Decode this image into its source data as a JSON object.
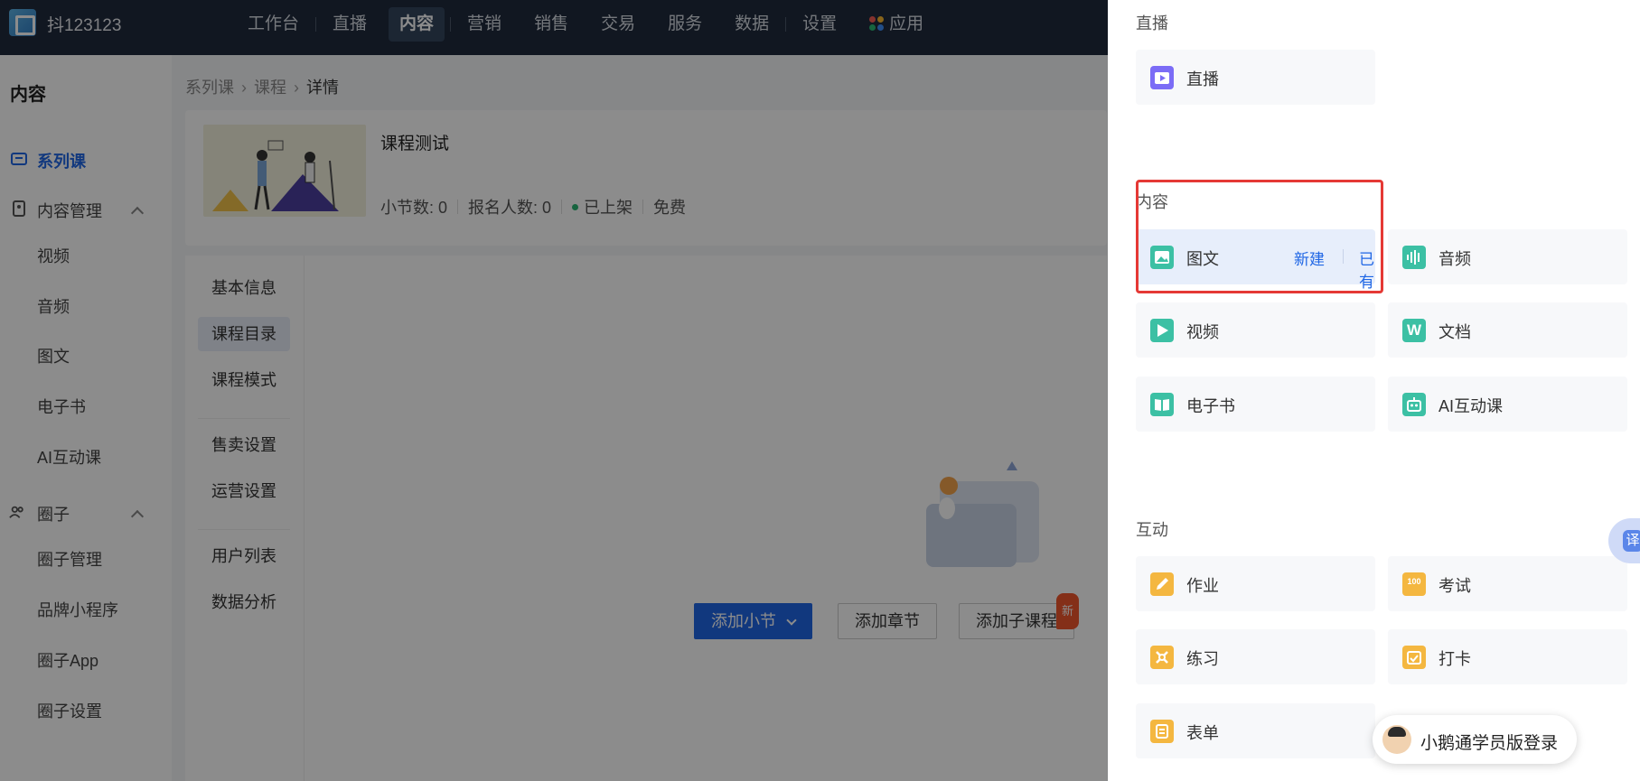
{
  "topbar": {
    "brand": "抖123123",
    "nav": [
      "工作台",
      "直播",
      "内容",
      "营销",
      "销售",
      "交易",
      "服务",
      "数据",
      "设置",
      "应用"
    ]
  },
  "sidebar": {
    "title": "内容",
    "items": [
      "系列课",
      "内容管理",
      "视频",
      "音频",
      "图文",
      "电子书",
      "AI互动课",
      "圈子",
      "圈子管理",
      "品牌小程序",
      "圈子App",
      "圈子设置"
    ]
  },
  "breadcrumb": [
    "系列课",
    "课程",
    "详情"
  ],
  "course": {
    "title": "课程测试",
    "lessons": "小节数: 0",
    "enrolled": "报名人数: 0",
    "status": "已上架",
    "price": "免费"
  },
  "subnav": [
    "基本信息",
    "课程目录",
    "课程模式",
    "售卖设置",
    "运营设置",
    "用户列表",
    "数据分析"
  ],
  "actions": {
    "add_section": "添加小节",
    "add_chapter": "添加章节",
    "add_subcourse": "添加子课程",
    "new_badge": "新"
  },
  "drawer": {
    "live_title": "直播",
    "live_item": "直播",
    "content_title": "内容",
    "content_items": [
      "图文",
      "音频",
      "视频",
      "文档",
      "电子书",
      "AI互动课"
    ],
    "tuwen_new": "新建",
    "tuwen_existing": "已有",
    "interact_title": "互动",
    "interact_items": [
      "作业",
      "考试",
      "练习",
      "打卡",
      "表单"
    ],
    "doc_letter": "W",
    "exam_text": "100"
  },
  "float_login": "小鹅通学员版登录",
  "side_tab_char": "译",
  "colors": {
    "primary": "#1f66e5",
    "highlight": "#e53935",
    "nav_bg": "#1f2a3d"
  }
}
